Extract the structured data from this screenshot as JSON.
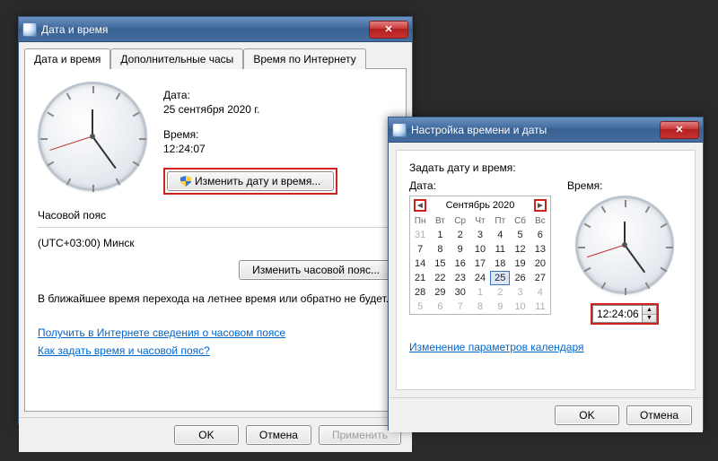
{
  "main": {
    "title": "Дата и время",
    "tabs": [
      "Дата и время",
      "Дополнительные часы",
      "Время по Интернету"
    ],
    "date_label": "Дата:",
    "date_value": "25 сентября 2020 г.",
    "time_label": "Время:",
    "time_value": "12:24:07",
    "change_dt_btn": "Изменить дату и время...",
    "tz_heading": "Часовой пояс",
    "tz_value": "(UTC+03:00) Минск",
    "change_tz_btn": "Изменить часовой пояс...",
    "dst_note": "В ближайшее время перехода на летнее время или обратно не будет.",
    "link_tz_info": "Получить в Интернете сведения о часовом поясе",
    "link_howto": "Как задать время и часовой пояс?",
    "ok": "OK",
    "cancel": "Отмена",
    "apply": "Применить"
  },
  "settings": {
    "title": "Настройка времени и даты",
    "prompt": "Задать дату и время:",
    "date_label": "Дата:",
    "time_label": "Время:",
    "month": "Сентябрь 2020",
    "dow": [
      "Пн",
      "Вт",
      "Ср",
      "Чт",
      "Пт",
      "Сб",
      "Вс"
    ],
    "grid": [
      {
        "n": "31",
        "o": true
      },
      {
        "n": "1"
      },
      {
        "n": "2"
      },
      {
        "n": "3"
      },
      {
        "n": "4"
      },
      {
        "n": "5"
      },
      {
        "n": "6"
      },
      {
        "n": "7"
      },
      {
        "n": "8"
      },
      {
        "n": "9"
      },
      {
        "n": "10"
      },
      {
        "n": "11"
      },
      {
        "n": "12"
      },
      {
        "n": "13"
      },
      {
        "n": "14"
      },
      {
        "n": "15"
      },
      {
        "n": "16"
      },
      {
        "n": "17"
      },
      {
        "n": "18"
      },
      {
        "n": "19"
      },
      {
        "n": "20"
      },
      {
        "n": "21"
      },
      {
        "n": "22"
      },
      {
        "n": "23"
      },
      {
        "n": "24"
      },
      {
        "n": "25",
        "sel": true
      },
      {
        "n": "26"
      },
      {
        "n": "27"
      },
      {
        "n": "28"
      },
      {
        "n": "29"
      },
      {
        "n": "30"
      },
      {
        "n": "1",
        "o": true
      },
      {
        "n": "2",
        "o": true
      },
      {
        "n": "3",
        "o": true
      },
      {
        "n": "4",
        "o": true
      },
      {
        "n": "5",
        "o": true
      },
      {
        "n": "6",
        "o": true
      },
      {
        "n": "7",
        "o": true
      },
      {
        "n": "8",
        "o": true
      },
      {
        "n": "9",
        "o": true
      },
      {
        "n": "10",
        "o": true
      },
      {
        "n": "11",
        "o": true
      }
    ],
    "time_value": "12:24:06",
    "cal_link": "Изменение параметров календаря",
    "ok": "OK",
    "cancel": "Отмена"
  }
}
